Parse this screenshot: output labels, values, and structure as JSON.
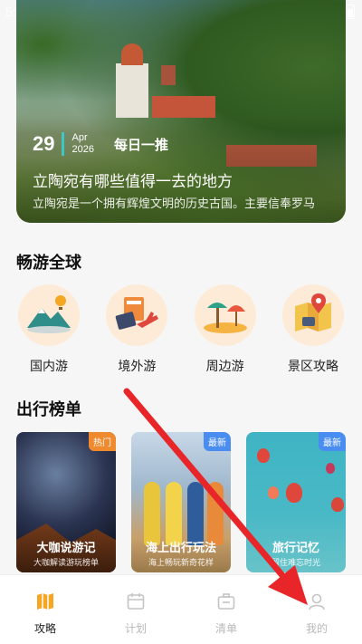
{
  "status_bar": {
    "time": "5:"
  },
  "hero": {
    "day": "29",
    "month": "Apr",
    "year": "2026",
    "daily_label": "每日一推",
    "title": "立陶宛有哪些值得一去的地方",
    "description": "立陶宛是一个拥有辉煌文明的历史古国。主要信奉罗马"
  },
  "explore": {
    "title": "畅游全球",
    "categories": [
      {
        "label": "国内游",
        "icon": "mountain-balloon-icon"
      },
      {
        "label": "境外游",
        "icon": "passport-plane-icon"
      },
      {
        "label": "周边游",
        "icon": "beach-umbrella-icon"
      },
      {
        "label": "景区攻略",
        "icon": "map-pin-icon"
      }
    ]
  },
  "ranking": {
    "title": "出行榜单",
    "cards": [
      {
        "badge": "热门",
        "badge_color": "#f08a2e",
        "title": "大咖说游记",
        "subtitle": "大咖解读游玩榜单"
      },
      {
        "badge": "最新",
        "badge_color": "#4a8df0",
        "title": "海上出行玩法",
        "subtitle": "海上畅玩新奇花样"
      },
      {
        "badge": "最新",
        "badge_color": "#4a8df0",
        "title": "旅行记忆",
        "subtitle": "留住难忘时光"
      }
    ]
  },
  "tabbar": {
    "tabs": [
      {
        "label": "攻略",
        "icon": "map-icon",
        "active": true
      },
      {
        "label": "计划",
        "icon": "calendar-icon",
        "active": false
      },
      {
        "label": "清单",
        "icon": "briefcase-icon",
        "active": false
      },
      {
        "label": "我的",
        "icon": "user-icon",
        "active": false
      }
    ]
  },
  "colors": {
    "accent": "#f5a623",
    "annotation_arrow": "#e8262a"
  }
}
